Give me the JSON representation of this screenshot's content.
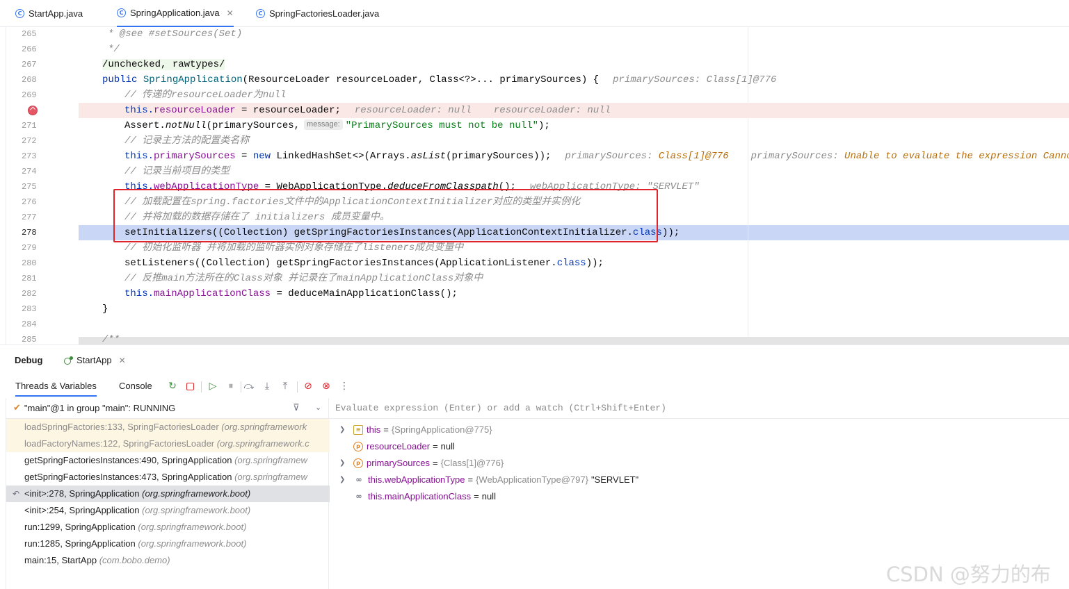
{
  "tabs": [
    {
      "label": "StartApp.java",
      "icon": "class-icon"
    },
    {
      "label": "SpringApplication.java",
      "icon": "class-icon",
      "active": true
    },
    {
      "label": "SpringFactoriesLoader.java",
      "icon": "class-icon"
    }
  ],
  "editor": {
    "line_numbers": [
      "265",
      "266",
      "267",
      "268",
      "269",
      "271",
      "272",
      "273",
      "274",
      "275",
      "276",
      "277",
      "278",
      "279",
      "280",
      "281",
      "282",
      "283",
      "284",
      "285"
    ],
    "breakpoint_line": "270",
    "current_line": "278",
    "code": {
      "l265": "* @see #setSources(Set)",
      "l266": "*/",
      "l267": "/unchecked, rawtypes/",
      "l268_kw": "public",
      "l268_name": "SpringApplication",
      "l268_params": "(ResourceLoader resourceLoader, Class<?>... primarySources) {",
      "l268_dbg": "primarySources: Class[1]@776",
      "l269": "// 传递的resourceLoader为null",
      "l270_this": "this.",
      "l270_field": "resourceLoader",
      "l270_rest": " = resourceLoader;",
      "l270_dbg1": "resourceLoader: null",
      "l270_dbg2": "resourceLoader: null",
      "l271_a": "Assert.",
      "l271_m": "notNull",
      "l271_b": "(primarySources,",
      "l271_hint": "message:",
      "l271_str": "\"PrimarySources must not be null\"",
      "l271_c": ");",
      "l272": "// 记录主方法的配置类名称",
      "l273_this": "this.",
      "l273_field": "primarySources",
      "l273_eq": " = ",
      "l273_new": "new",
      "l273_rest1": " LinkedHashSet<>(Arrays.",
      "l273_m": "asList",
      "l273_rest2": "(primarySources));",
      "l273_dbg1": "primarySources: ",
      "l273_dbg1v": "Class[1]@776",
      "l273_dbg2": "primarySources: ",
      "l273_dbg2v": "Unable to evaluate the expression Cannot find",
      "l274": "// 记录当前项目的类型",
      "l275_this": "this.",
      "l275_field": "webApplicationType",
      "l275_rest1": " = WebApplicationType.",
      "l275_m": "deduceFromClasspath",
      "l275_rest2": "();",
      "l275_dbg": "webApplicationType: \"SERVLET\"",
      "l276": "// 加载配置在spring.factories文件中的ApplicationContextInitializer对应的类型并实例化",
      "l277": "// 并将加载的数据存储在了 initializers 成员变量中。",
      "l278_a": "setInitializers((Collection) getSpringFactoriesInstances(ApplicationContextInitializer.",
      "l278_kw": "class",
      "l278_b": "));",
      "l279": "// 初始化监听器 并将加载的监听器实例对象存储在了listeners成员变量中",
      "l280_a": "setListeners((Collection) getSpringFactoriesInstances(ApplicationListener.",
      "l280_kw": "class",
      "l280_b": "));",
      "l281": "// 反推main方法所在的Class对象 并记录在了mainApplicationClass对象中",
      "l282_this": "this.",
      "l282_field": "mainApplicationClass",
      "l282_rest": " = deduceMainApplicationClass();",
      "l283": "}",
      "l285": "/**"
    }
  },
  "debug": {
    "title": "Debug",
    "session_tab": "StartApp",
    "tabs": [
      "Threads & Variables",
      "Console"
    ],
    "thread": "\"main\"@1 in group \"main\": RUNNING",
    "frames": [
      {
        "method": "loadSpringFactories:133, SpringFactoriesLoader",
        "pkg": "(org.springframework",
        "kind": "lib"
      },
      {
        "method": "loadFactoryNames:122, SpringFactoriesLoader",
        "pkg": "(org.springframework.c",
        "kind": "lib"
      },
      {
        "method": "getSpringFactoriesInstances:490, SpringApplication",
        "pkg": "(org.springframew",
        "kind": "normal"
      },
      {
        "method": "getSpringFactoriesInstances:473, SpringApplication",
        "pkg": "(org.springframew",
        "kind": "normal"
      },
      {
        "method": "<init>:278, SpringApplication",
        "pkg": "(org.springframework.boot)",
        "kind": "selected"
      },
      {
        "method": "<init>:254, SpringApplication",
        "pkg": "(org.springframework.boot)",
        "kind": "normal"
      },
      {
        "method": "run:1299, SpringApplication",
        "pkg": "(org.springframework.boot)",
        "kind": "normal"
      },
      {
        "method": "run:1285, SpringApplication",
        "pkg": "(org.springframework.boot)",
        "kind": "normal"
      },
      {
        "method": "main:15, StartApp",
        "pkg": "(com.bobo.demo)",
        "kind": "normal"
      }
    ],
    "eval_placeholder": "Evaluate expression (Enter) or add a watch (Ctrl+Shift+Enter)",
    "variables": [
      {
        "name": "this",
        "value": "{SpringApplication@775}",
        "extra": "",
        "expandable": true,
        "icon": "stack-icon"
      },
      {
        "name": "resourceLoader",
        "value": "null",
        "extra": "",
        "expandable": false,
        "icon": "parameter-icon"
      },
      {
        "name": "primarySources",
        "value": "{Class[1]@776}",
        "extra": "",
        "expandable": true,
        "icon": "parameter-icon"
      },
      {
        "name": "this.webApplicationType",
        "value": "{WebApplicationType@797}",
        "extra": "\"SERVLET\"",
        "expandable": true,
        "icon": "watch-glasses-icon"
      },
      {
        "name": "this.mainApplicationClass",
        "value": "null",
        "extra": "",
        "expandable": false,
        "icon": "watch-glasses-icon"
      }
    ]
  },
  "watermark": "CSDN @努力的布布",
  "colors": {
    "accent": "#3574f0",
    "breakpoint": "#e55765",
    "highlight_box": "#e0242b"
  }
}
